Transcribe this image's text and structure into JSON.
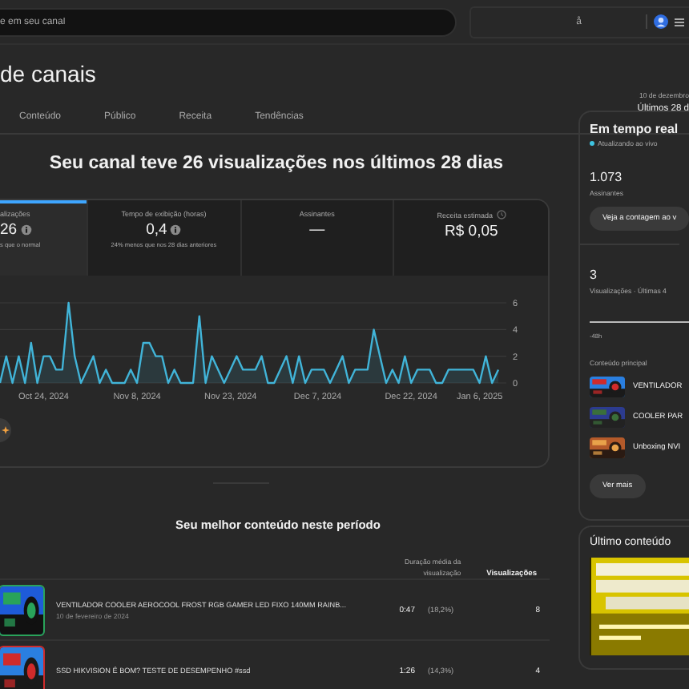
{
  "search": {
    "placeholder": "e em seu canal"
  },
  "account": {
    "glyph": "å"
  },
  "page_title": "de canais",
  "tabs": [
    {
      "label": "Conteúdo",
      "selected": false
    },
    {
      "label": "Público",
      "selected": false
    },
    {
      "label": "Receita",
      "selected": false
    },
    {
      "label": "Tendências",
      "selected": false
    }
  ],
  "period": {
    "range": "10 de dezembro",
    "label": "Últimos 28 d"
  },
  "headline": "Seu canal teve 26 visualizações nos últimos 28 dias",
  "metrics": [
    {
      "label": "alizações",
      "value": "26",
      "note": "s que o normal",
      "info": true,
      "clock": false,
      "selected": true
    },
    {
      "label": "Tempo de exibição (horas)",
      "value": "0,4",
      "note": "24% menos que nos 28 dias anteriores",
      "info": true,
      "clock": false,
      "selected": false
    },
    {
      "label": "Assinantes",
      "value": "—",
      "info": false,
      "clock": false,
      "selected": false
    },
    {
      "label": "Receita estimada",
      "value": "R$ 0,05",
      "info": false,
      "clock": true,
      "selected": false
    }
  ],
  "chart_data": {
    "type": "area",
    "ylim": [
      0,
      6
    ],
    "yticks": [
      0,
      2,
      4,
      6
    ],
    "categories": [
      null,
      null,
      null,
      null,
      null,
      null,
      null,
      "Oct 24, 2024",
      null,
      null,
      null,
      null,
      null,
      null,
      null,
      null,
      null,
      null,
      null,
      null,
      null,
      null,
      "Nov 8, 2024",
      null,
      null,
      null,
      null,
      null,
      null,
      null,
      null,
      null,
      null,
      null,
      null,
      null,
      null,
      "Nov 23, 2024",
      null,
      null,
      null,
      null,
      null,
      null,
      null,
      null,
      null,
      null,
      null,
      null,
      null,
      "Dec 7, 2024",
      null,
      null,
      null,
      null,
      null,
      null,
      null,
      null,
      null,
      null,
      null,
      null,
      null,
      null,
      "Dec 22, 2024",
      null,
      null,
      null,
      null,
      null,
      null,
      null,
      null,
      null,
      null,
      "Jan 6, 2025",
      null,
      null,
      null
    ],
    "series": [
      {
        "color": "#41b4d8",
        "values": [
          0,
          2,
          0,
          2,
          0,
          3,
          0,
          2,
          2,
          1,
          1,
          6,
          2,
          0,
          1,
          2,
          0,
          1,
          0,
          0,
          0,
          1,
          0,
          3,
          3,
          2,
          2,
          0,
          1,
          0,
          0,
          0,
          5,
          0,
          2,
          1,
          0,
          1,
          2,
          1,
          1,
          1,
          2,
          0,
          0,
          1,
          2,
          0,
          2,
          0,
          1,
          1,
          1,
          0,
          1,
          2,
          0,
          1,
          1,
          1,
          4,
          2,
          0,
          1,
          0,
          2,
          0,
          1,
          1,
          1,
          0,
          0,
          1,
          1,
          1,
          1,
          1,
          0,
          2,
          0,
          1
        ]
      }
    ]
  },
  "best_content": {
    "title": "Seu melhor conteúdo neste período",
    "columns": [
      "Duração média da visualização",
      "Visualizações"
    ],
    "rows": [
      {
        "title": "VENTILADOR COOLER AEROCOOL FROST RGB GAMER LED FIXO 140MM RAINB...",
        "date": "10 de fevereiro de 2024",
        "duration": "0:47",
        "percent": "(18,2%)",
        "views": "8"
      },
      {
        "title": "SSD HIKVISION É BOM? TESTE DE DESEMPENHO #ssd",
        "duration": "1:26",
        "percent": "(14,3%)",
        "views": "4"
      }
    ]
  },
  "realtime": {
    "title": "Em tempo real",
    "status": "Atualizando ao vivo",
    "subscribers": "1.073",
    "subscribers_label": "Assinantes",
    "count_button": "Veja a contagem ao v",
    "views": "3",
    "views_label": "Visualizações · Últimas 4",
    "axis_label": "-48h",
    "top_label": "Conteúdo principal",
    "top": [
      {
        "title": "VENTILADOR"
      },
      {
        "title": "COOLER PAR"
      },
      {
        "title": "Unboxing NVI"
      }
    ],
    "more_button": "Ver mais"
  },
  "latest": {
    "title": "Último conteúdo"
  }
}
